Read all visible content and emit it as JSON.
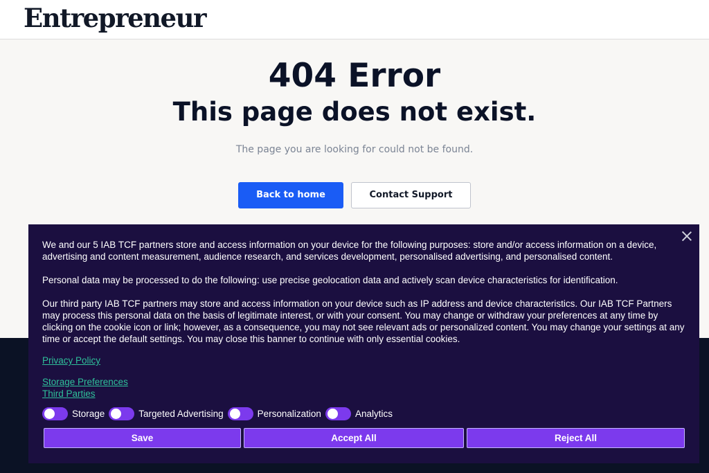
{
  "header": {
    "logo": "Entrepreneur"
  },
  "main": {
    "error_title": "404 Error",
    "subtitle": "This page does not exist.",
    "message": "The page you are looking for could not be found.",
    "back_home_label": "Back to home",
    "contact_label": "Contact Support"
  },
  "consent": {
    "paragraph1": "We and our 5 IAB TCF partners store and access information on your device for the following purposes: store and/or access information on a device, advertising and content measurement, audience research, and services development, personalised advertising, and personalised content.",
    "paragraph2": "Personal data may be processed to do the following: use precise geolocation data and actively scan device characteristics for identification.",
    "paragraph3": "Our third party IAB TCF partners may store and access information on your device such as IP address and device characteristics. Our IAB TCF Partners may process this personal data on the basis of legitimate interest, or with your consent. You may change or withdraw your preferences at any time by clicking on the cookie icon or link; however, as a consequence, you may not see relevant ads or personalized content. You may change your settings at any time or accept the default settings. You may close this banner to continue with only essential cookies.",
    "privacy_policy": "Privacy Policy",
    "storage_preferences": "Storage Preferences",
    "third_parties": "Third Parties",
    "toggles": [
      "Storage",
      "Targeted Advertising",
      "Personalization",
      "Analytics"
    ],
    "save_label": "Save",
    "accept_label": "Accept All",
    "reject_label": "Reject All"
  },
  "colors": {
    "primary_button": "#1a5cf5",
    "consent_bg": "#1b0f40",
    "consent_accent": "#7c3aed",
    "link": "#2fc09a",
    "heading": "#0b1227"
  }
}
